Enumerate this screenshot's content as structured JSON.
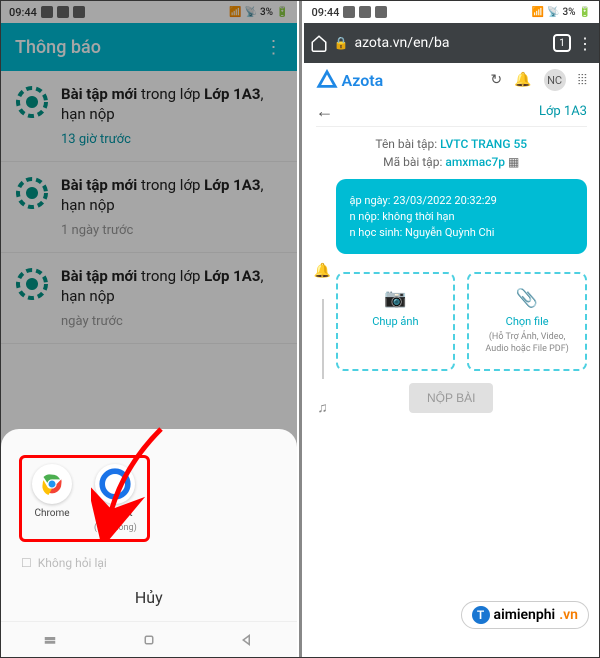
{
  "left": {
    "time": "09:44",
    "battery": "3%",
    "header": "Thông báo",
    "notifs": [
      {
        "bold": "Bài tập mới",
        "rest": " trong lớp ",
        "cls": "Lớp 1A3",
        "tail": ", hạn nộp",
        "time": "13 giờ trước",
        "timeClass": ""
      },
      {
        "bold": "Bài tập mới",
        "rest": " trong lớp ",
        "cls": "Lớp 1A3",
        "tail": ", hạn nộp",
        "time": "1 ngày trước",
        "timeClass": "gray"
      },
      {
        "bold": "Bài tập mới",
        "rest": " trong lớp ",
        "cls": "Lớp 1A3",
        "tail": ", hạn nộp",
        "time": "ngày trước",
        "timeClass": "gray"
      }
    ],
    "apps": {
      "a": {
        "name": "Chrome"
      },
      "b": {
        "name": "Internet",
        "sub": "(Hệ thống)"
      }
    },
    "grey": "Không hỏi lại",
    "cancel": "Hủy"
  },
  "right": {
    "time": "09:44",
    "battery": "3%",
    "url": "azota.vn/en/ba",
    "tabcount": "1",
    "brand": "Azota",
    "avatar": "NC",
    "classname": "Lớp 1A3",
    "info": {
      "l1a": "Tên bài tập:",
      "l1b": "LVTC TRANG 55",
      "l2a": "Mã bài tập:",
      "l2b": "amxmac7p"
    },
    "card": {
      "a": "ập ngày: 23/03/2022 20:32:29",
      "b": "n nộp: không thời hạn",
      "c": "n học sinh: Nguyễn Quỳnh Chi"
    },
    "upload1": {
      "title": "Chụp ảnh"
    },
    "upload2": {
      "title": "Chọn file",
      "sub": "(Hỗ Trợ Ảnh, Video, Audio hoặc File PDF)"
    },
    "submit": "NỘP BÀI",
    "watermark": {
      "a": "aimienphi",
      "b": ".vn"
    }
  }
}
